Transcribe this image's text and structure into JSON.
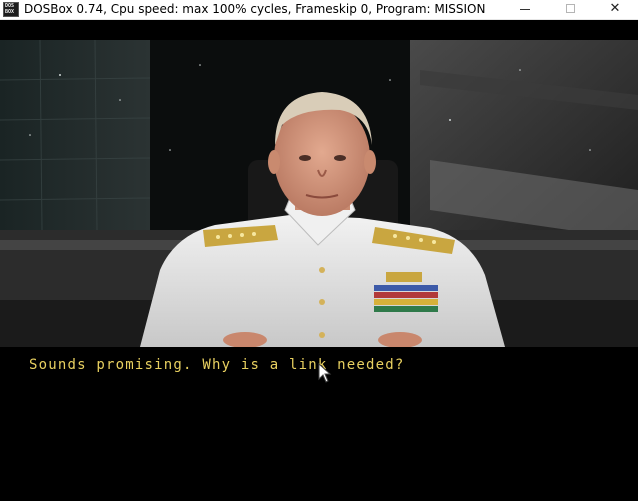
{
  "window": {
    "icon_line1": "DOS",
    "icon_line2": "BOX",
    "title": "DOSBox 0.74, Cpu speed: max 100% cycles, Frameskip  0, Program:  MISSION",
    "controls": [
      "minimize",
      "maximize",
      "close"
    ],
    "close_glyph": "✕"
  },
  "game": {
    "scene": "admiral-briefing",
    "dialogue": "Sounds promising. Why is a link needed?",
    "colors": {
      "dialogue_text": "#e8d060",
      "background": "#000000"
    }
  }
}
